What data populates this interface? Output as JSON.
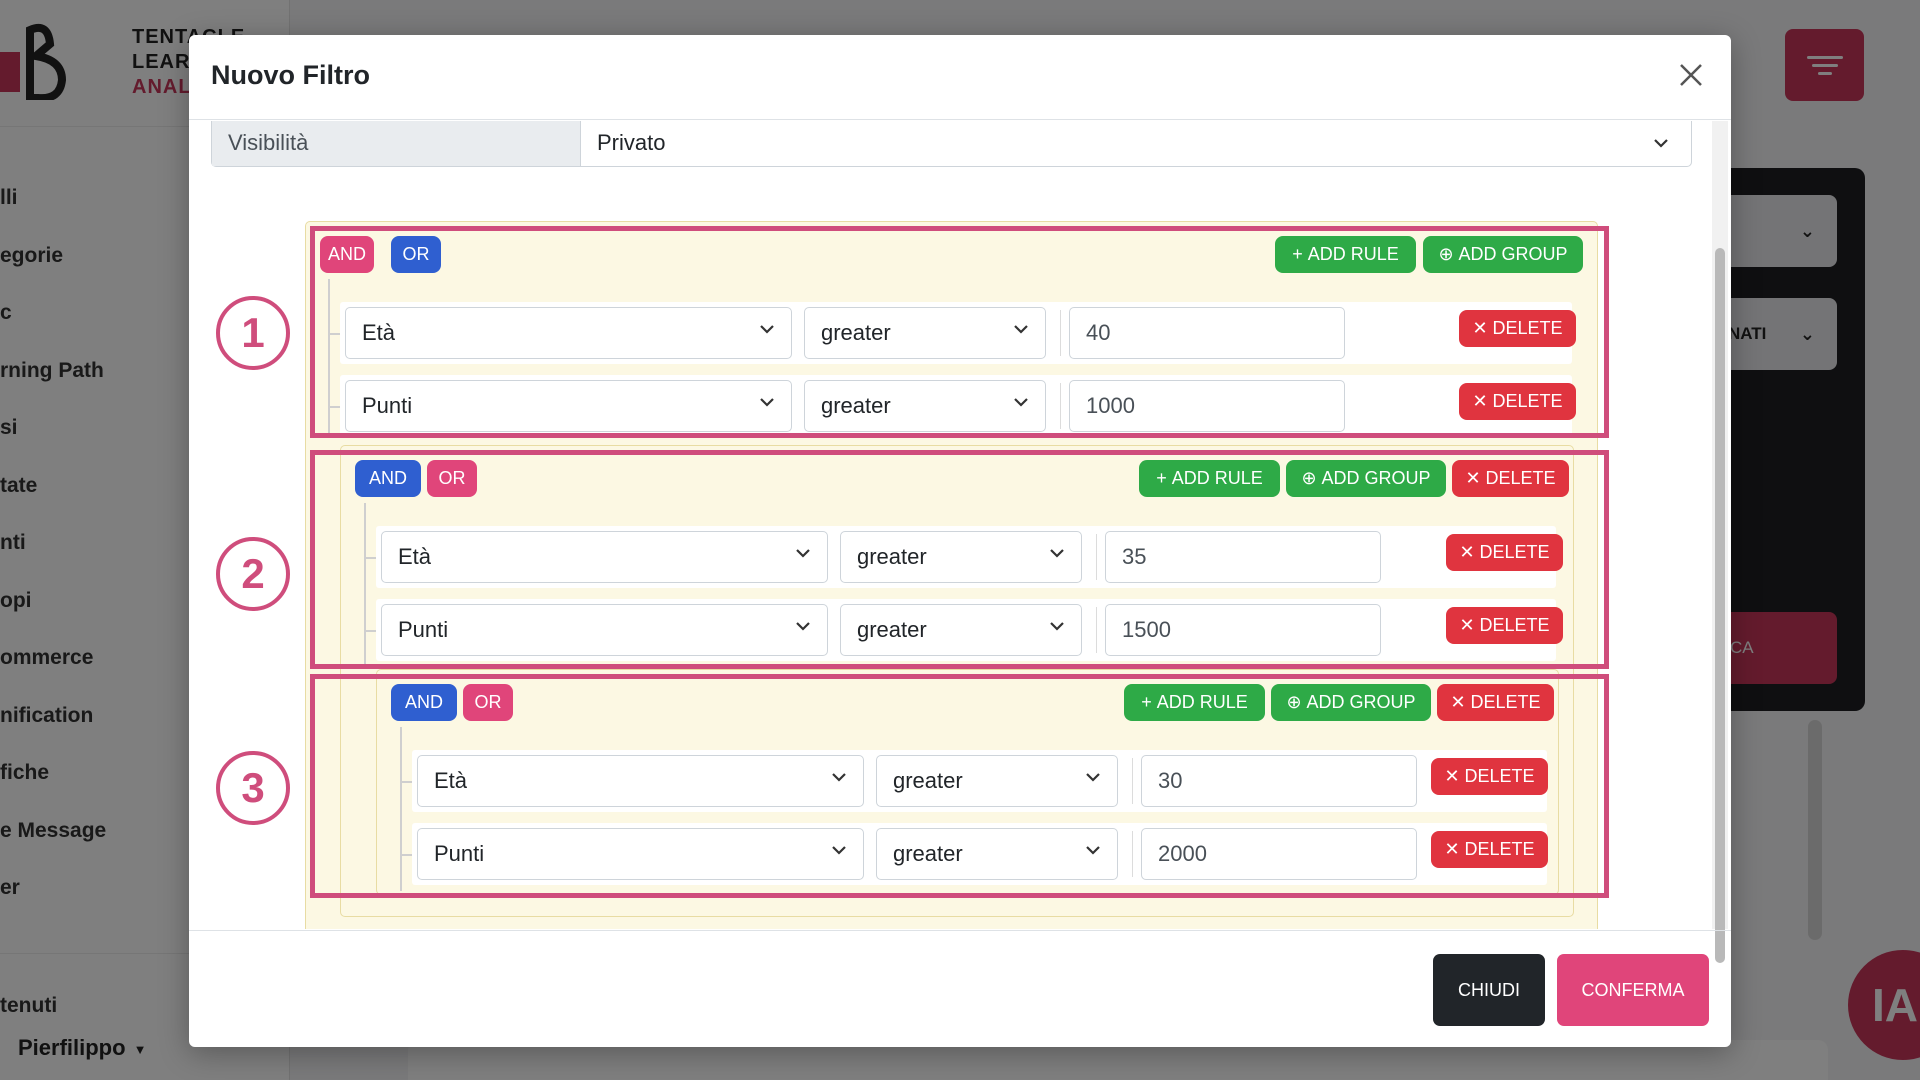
{
  "background": {
    "brand_lines": [
      "TENTACLE",
      "LEAR",
      "ANAL"
    ],
    "menu": [
      "lli",
      "egorie",
      "c",
      "rning Path",
      "si",
      "tate",
      "nti",
      "opi",
      "ommerce",
      "nification",
      "fiche",
      "e Message",
      "er",
      "tenuti"
    ],
    "user": "Pierfilippo",
    "select1": "",
    "select2": "NATI",
    "pink_button": "CA",
    "avatar": "IA"
  },
  "modal": {
    "title": "Nuovo Filtro",
    "visibility_label": "Visibilità",
    "visibility_value": "Privato",
    "footer": {
      "close_label": "CHIUDI",
      "confirm_label": "CONFERMA"
    }
  },
  "query": {
    "and_label": "AND",
    "or_label": "OR",
    "add_rule_label": "ADD RULE",
    "add_group_label": "ADD GROUP",
    "delete_label": "DELETE",
    "groups": [
      {
        "id": "1",
        "conjunction": "AND",
        "rules": [
          {
            "field": "Età",
            "operator": "greater",
            "value": "40"
          },
          {
            "field": "Punti",
            "operator": "greater",
            "value": "1000"
          }
        ]
      },
      {
        "id": "2",
        "conjunction": "OR",
        "rules": [
          {
            "field": "Età",
            "operator": "greater",
            "value": "35"
          },
          {
            "field": "Punti",
            "operator": "greater",
            "value": "1500"
          }
        ]
      },
      {
        "id": "3",
        "conjunction": "OR",
        "rules": [
          {
            "field": "Età",
            "operator": "greater",
            "value": "30"
          },
          {
            "field": "Punti",
            "operator": "greater",
            "value": "2000"
          }
        ]
      }
    ]
  },
  "colors": {
    "active_conjunction": "#2f5fd0",
    "inactive_conjunction": "#e0457a",
    "add_button": "#2eaa47",
    "delete_button": "#e0343f",
    "highlight": "#cf4d7c",
    "group_bg": "#fcf8e3"
  }
}
